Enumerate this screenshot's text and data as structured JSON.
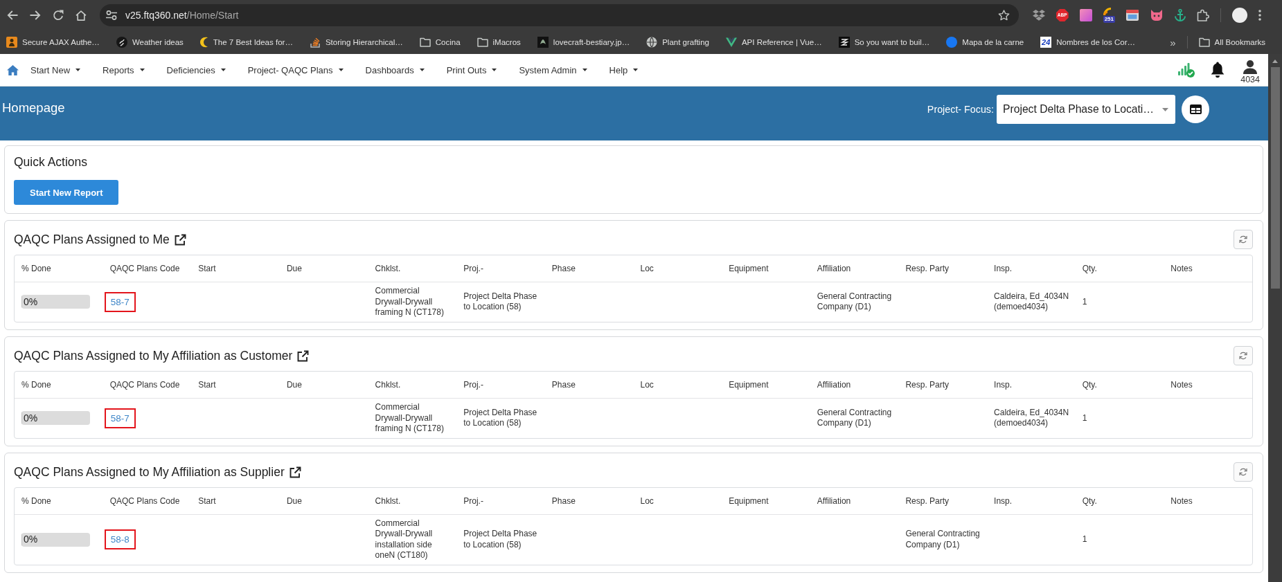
{
  "browser": {
    "url": {
      "host": "v25.ftq360.net",
      "path": "/Home/Start"
    },
    "extension_label": "ABP",
    "extension_badge": "251"
  },
  "bookmarks": {
    "items": [
      {
        "label": "Secure AJAX Authe…",
        "kind": "page"
      },
      {
        "label": "Weather ideas",
        "kind": "page"
      },
      {
        "label": "The 7 Best Ideas for…",
        "kind": "page"
      },
      {
        "label": "Storing Hierarchical…",
        "kind": "page"
      },
      {
        "label": "Cocina",
        "kind": "folder"
      },
      {
        "label": "iMacros",
        "kind": "folder"
      },
      {
        "label": "lovecraft-bestiary.jp…",
        "kind": "page"
      },
      {
        "label": "Plant grafting",
        "kind": "page"
      },
      {
        "label": "API Reference | Vue…",
        "kind": "page"
      },
      {
        "label": "So you want to buil…",
        "kind": "page"
      },
      {
        "label": "Mapa de la carne",
        "kind": "page"
      },
      {
        "label": "Nombres de los Cor…",
        "kind": "page",
        "icon_text": "24"
      }
    ],
    "overflow": "»",
    "all": {
      "label": "All Bookmarks",
      "kind": "folder"
    }
  },
  "navbar": {
    "menu": [
      {
        "label": "Start New"
      },
      {
        "label": "Reports"
      },
      {
        "label": "Deficiencies"
      },
      {
        "label": "Project- QAQC Plans"
      },
      {
        "label": "Dashboards"
      },
      {
        "label": "Print Outs"
      },
      {
        "label": "System Admin"
      },
      {
        "label": "Help"
      }
    ],
    "user": "4034"
  },
  "header": {
    "title": "Homepage",
    "focus": {
      "label": "Project- Focus:",
      "value": "Project Delta Phase to Locati…"
    }
  },
  "quick_actions": {
    "title": "Quick Actions",
    "button": "Start New Report"
  },
  "sections": [
    {
      "title": "QAQC Plans Assigned to Me",
      "columns": [
        "% Done",
        "QAQC Plans Code",
        "Start",
        "Due",
        "Chklst.",
        "Proj.-",
        "Phase",
        "Loc",
        "Equipment",
        "Affiliation",
        "Resp. Party",
        "Insp.",
        "Qty.",
        "Notes"
      ],
      "rows": [
        {
          "done": {
            "text": "0%",
            "level": 0
          },
          "code": {
            "text": "58-7",
            "highlighted": true
          },
          "checklist": "Commercial Drywall-Drywall framing N (CT178)",
          "project": "Project Delta Phase to Location (58)",
          "affiliation": "General Contracting Company (D1)",
          "inspector": "Caldeira, Ed_4034N (demoed4034)",
          "quantity": "1"
        }
      ]
    },
    {
      "title": "QAQC Plans Assigned to My Affiliation as Customer",
      "columns": [
        "% Done",
        "QAQC Plans Code",
        "Start",
        "Due",
        "Chklst.",
        "Proj.-",
        "Phase",
        "Loc",
        "Equipment",
        "Affiliation",
        "Resp. Party",
        "Insp.",
        "Qty.",
        "Notes"
      ],
      "rows": [
        {
          "done": {
            "text": "0%",
            "level": 0
          },
          "code": {
            "text": "58-7",
            "highlighted": true
          },
          "checklist": "Commercial Drywall-Drywall framing N (CT178)",
          "project": "Project Delta Phase to Location (58)",
          "affiliation": "General Contracting Company (D1)",
          "inspector": "Caldeira, Ed_4034N (demoed4034)",
          "quantity": "1"
        }
      ]
    },
    {
      "title": "QAQC Plans Assigned to My Affiliation as Supplier",
      "columns": [
        "% Done",
        "QAQC Plans Code",
        "Start",
        "Due",
        "Chklst.",
        "Proj.-",
        "Phase",
        "Loc",
        "Equipment",
        "Affiliation",
        "Resp. Party",
        "Insp.",
        "Qty.",
        "Notes"
      ],
      "rows": [
        {
          "done": {
            "text": "0%",
            "level": 0
          },
          "code": {
            "text": "58-8",
            "highlighted": true
          },
          "checklist": "Commercial Drywall-Drywall installation side oneN (CT180)",
          "project": "Project Delta Phase to Location (58)",
          "responsible_party": "General Contracting Company (D1)",
          "quantity": "1"
        }
      ]
    }
  ]
}
